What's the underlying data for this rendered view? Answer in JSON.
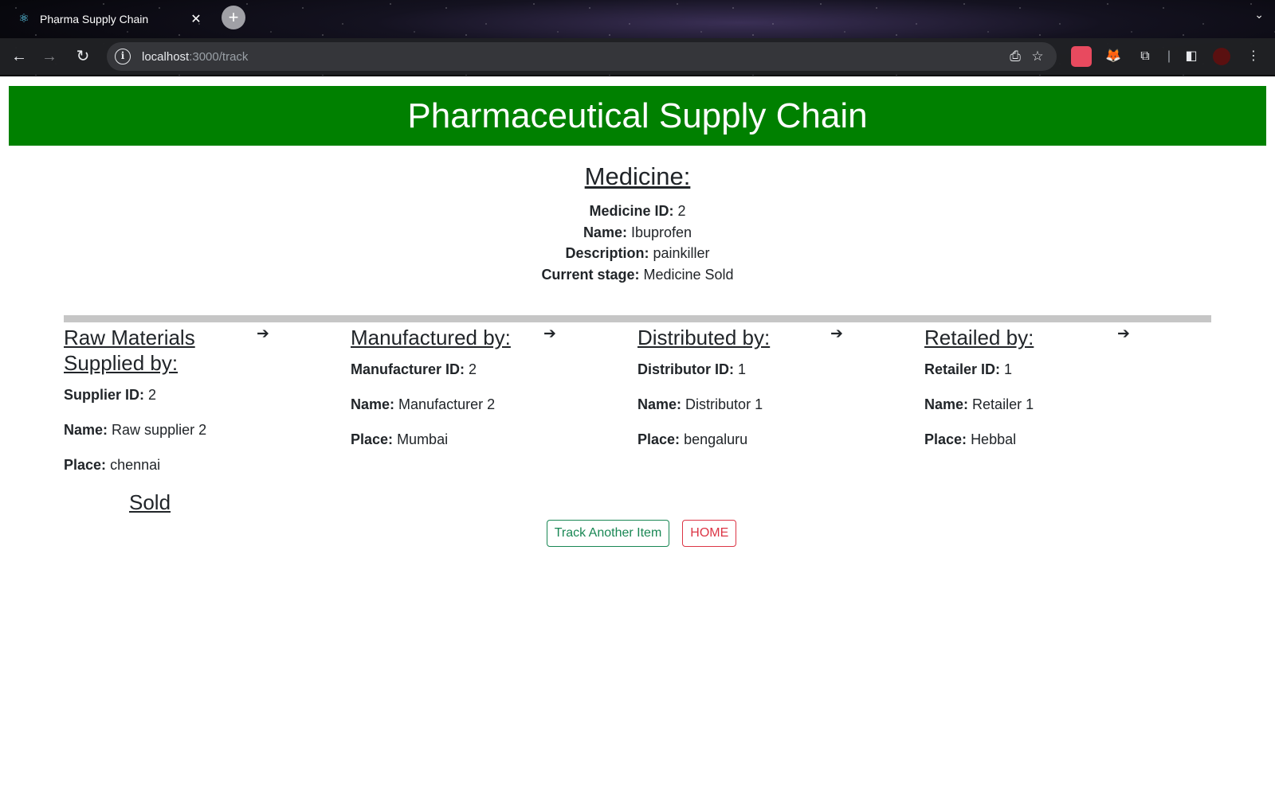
{
  "browser": {
    "tab_title": "Pharma Supply Chain",
    "tab_favicon": "react-icon",
    "close_glyph": "✕",
    "new_tab_glyph": "+",
    "url_host": "localhost",
    "url_path": ":3000/track",
    "icons": [
      "back-icon",
      "forward-icon",
      "reload-icon",
      "site-info-icon",
      "install-app-icon",
      "bookmark-star-icon",
      "extension-icon",
      "metamask-fox-icon",
      "extensions-puzzle-icon",
      "side-panel-icon",
      "profile-avatar-icon",
      "more-menu-icon"
    ]
  },
  "header": {
    "title": "Pharmaceutical Supply Chain",
    "background_color": "#008000"
  },
  "medicine": {
    "heading": "Medicine:",
    "id_label": "Medicine ID:",
    "id_value": "2",
    "name_label": "Name:",
    "name_value": "Ibuprofen",
    "description_label": "Description:",
    "description_value": "painkiller",
    "stage_label": "Current stage:",
    "stage_value": "Medicine Sold"
  },
  "stages": [
    {
      "heading": "Raw Materials Supplied by:",
      "id_label": "Supplier ID:",
      "id_value": "2",
      "name_label": "Name:",
      "name_value": "Raw supplier 2",
      "place_label": "Place:",
      "place_value": "chennai"
    },
    {
      "heading": "Manufactured by:",
      "id_label": "Manufacturer ID:",
      "id_value": "2",
      "name_label": "Name:",
      "name_value": "Manufacturer 2",
      "place_label": "Place:",
      "place_value": "Mumbai"
    },
    {
      "heading": "Distributed by:",
      "id_label": "Distributor ID:",
      "id_value": "1",
      "name_label": "Name:",
      "name_value": "Distributor 1",
      "place_label": "Place:",
      "place_value": "bengaluru"
    },
    {
      "heading": "Retailed by:",
      "id_label": "Retailer ID:",
      "id_value": "1",
      "name_label": "Name:",
      "name_value": "Retailer 1",
      "place_label": "Place:",
      "place_value": "Hebbal"
    }
  ],
  "arrow_glyph": "➔",
  "sold_label": "Sold",
  "buttons": {
    "track_label": "Track Another Item",
    "home_label": "HOME",
    "track_color": "#198754",
    "home_color": "#dc3545"
  }
}
